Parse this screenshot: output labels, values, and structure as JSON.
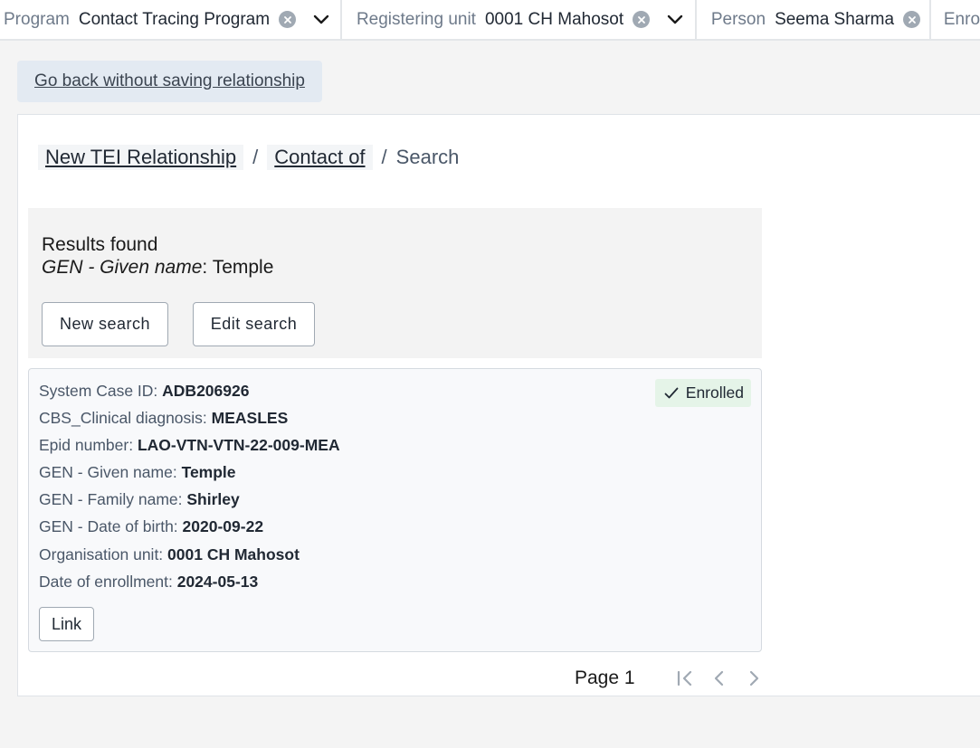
{
  "topbar": {
    "program": {
      "label": "Program",
      "value": "Contact Tracing Program"
    },
    "registering_unit": {
      "label": "Registering unit",
      "value": "0001 CH Mahosot"
    },
    "person": {
      "label": "Person",
      "value": "Seema Sharma"
    },
    "enrollment": {
      "label": "Enro"
    }
  },
  "back_button": "Go back without saving relationship",
  "breadcrumb": {
    "items": [
      "New TEI Relationship",
      "Contact of"
    ],
    "separator": "/",
    "current": "Search"
  },
  "results": {
    "title": "Results found",
    "criteria_field": "GEN - Given name",
    "criteria_sep": ": ",
    "criteria_value": "Temple",
    "new_search": "New search",
    "edit_search": "Edit search"
  },
  "tei": {
    "badge": "Enrolled",
    "attributes": [
      {
        "label": "System Case ID: ",
        "value": "ADB206926"
      },
      {
        "label": "CBS_Clinical diagnosis: ",
        "value": "MEASLES"
      },
      {
        "label": "Epid number: ",
        "value": "LAO-VTN-VTN-22-009-MEA"
      },
      {
        "label": "GEN - Given name: ",
        "value": "Temple"
      },
      {
        "label": "GEN - Family name: ",
        "value": "Shirley"
      },
      {
        "label": "GEN - Date of birth: ",
        "value": "2020-09-22"
      },
      {
        "label": "Organisation unit: ",
        "value": "0001 CH Mahosot"
      },
      {
        "label": "Date of enrollment: ",
        "value": "2024-05-13"
      }
    ],
    "link_button": "Link"
  },
  "pagination": {
    "page_label": "Page 1"
  },
  "icons": {
    "clear": "clear-circle-icon",
    "dropdown": "chevron-down-icon",
    "check": "check-icon",
    "first": "first-page-icon",
    "prev": "chevron-left-icon",
    "next": "chevron-right-icon"
  },
  "colors": {
    "badge_bg": "#e5f4e8",
    "back_button_bg": "#e3eaf2",
    "results_bg": "#f3f3f3"
  }
}
